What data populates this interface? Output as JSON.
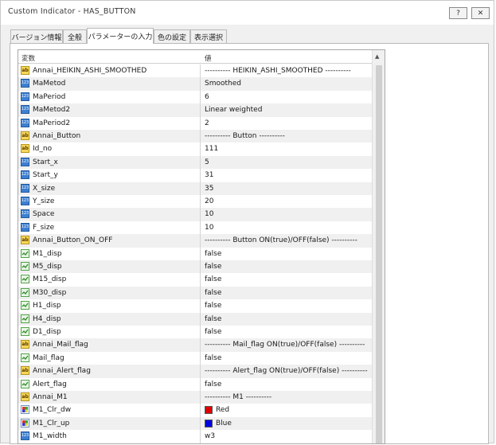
{
  "window": {
    "title": "Custom Indicator - HAS_BUTTON",
    "help_label": "?",
    "close_label": "✕"
  },
  "tabs": [
    {
      "label": "バージョン情報"
    },
    {
      "label": "全般"
    },
    {
      "label": "パラメーターの入力"
    },
    {
      "label": "色の設定"
    },
    {
      "label": "表示選択"
    }
  ],
  "grid": {
    "col_variable": "変数",
    "col_value": "値"
  },
  "params": [
    {
      "type": "string",
      "name": "Annai_HEIKIN_ASHI_SMOOTHED",
      "value": "---------- HEIKIN_ASHI_SMOOTHED ----------"
    },
    {
      "type": "int",
      "name": "MaMetod",
      "value": "Smoothed"
    },
    {
      "type": "int",
      "name": "MaPeriod",
      "value": "6"
    },
    {
      "type": "int",
      "name": "MaMetod2",
      "value": "Linear weighted"
    },
    {
      "type": "int",
      "name": "MaPeriod2",
      "value": "2"
    },
    {
      "type": "string",
      "name": "Annai_Button",
      "value": "---------- Button ----------"
    },
    {
      "type": "string",
      "name": "Id_no",
      "value": "111"
    },
    {
      "type": "int",
      "name": "Start_x",
      "value": "5"
    },
    {
      "type": "int",
      "name": "Start_y",
      "value": "31"
    },
    {
      "type": "int",
      "name": "X_size",
      "value": "35"
    },
    {
      "type": "int",
      "name": "Y_size",
      "value": "20"
    },
    {
      "type": "int",
      "name": "Space",
      "value": "10"
    },
    {
      "type": "int",
      "name": "F_size",
      "value": "10"
    },
    {
      "type": "string",
      "name": "Annai_Button_ON_OFF",
      "value": "---------- Button ON(true)/OFF(false) ----------"
    },
    {
      "type": "bool",
      "name": "M1_disp",
      "value": "false"
    },
    {
      "type": "bool",
      "name": "M5_disp",
      "value": "false"
    },
    {
      "type": "bool",
      "name": "M15_disp",
      "value": "false"
    },
    {
      "type": "bool",
      "name": "M30_disp",
      "value": "false"
    },
    {
      "type": "bool",
      "name": "H1_disp",
      "value": "false"
    },
    {
      "type": "bool",
      "name": "H4_disp",
      "value": "false"
    },
    {
      "type": "bool",
      "name": "D1_disp",
      "value": "false"
    },
    {
      "type": "string",
      "name": "Annai_Mail_flag",
      "value": "---------- Mail_flag ON(true)/OFF(false) ----------"
    },
    {
      "type": "bool",
      "name": "Mail_flag",
      "value": "false"
    },
    {
      "type": "string",
      "name": "Annai_Alert_flag",
      "value": "---------- Alert_flag ON(true)/OFF(false) ----------"
    },
    {
      "type": "bool",
      "name": "Alert_flag",
      "value": "false"
    },
    {
      "type": "string",
      "name": "Annai_M1",
      "value": "---------- M1 ----------"
    },
    {
      "type": "color",
      "name": "M1_Clr_dw",
      "value": "Red",
      "color": "#e00000"
    },
    {
      "type": "color",
      "name": "M1_Clr_up",
      "value": "Blue",
      "color": "#0000e0"
    },
    {
      "type": "int",
      "name": "M1_width",
      "value": "w3"
    }
  ]
}
